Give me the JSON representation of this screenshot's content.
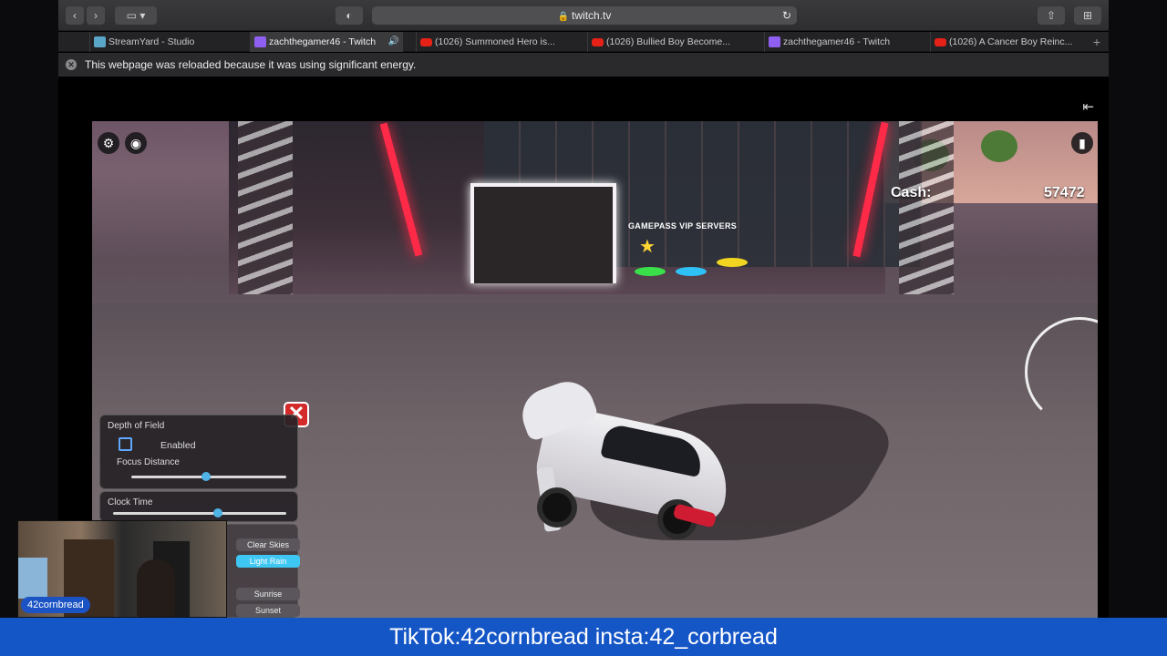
{
  "browser": {
    "url": "twitch.tv",
    "tabs": [
      {
        "label": "StreamYard - Studio",
        "favicon": "streamyard-icon",
        "active": false
      },
      {
        "label": "zachthegamer46 - Twitch",
        "favicon": "twitch-icon",
        "active": true
      },
      {
        "label": "(1026) Summoned Hero is...",
        "favicon": "youtube-icon",
        "active": false
      },
      {
        "label": "(1026) Bullied Boy Become...",
        "favicon": "youtube-icon",
        "active": false
      },
      {
        "label": "zachthegamer46 - Twitch",
        "favicon": "twitch-icon",
        "active": false
      },
      {
        "label": "(1026) A Cancer Boy Reinc...",
        "favicon": "youtube-icon",
        "active": false
      }
    ],
    "notice": "This webpage was reloaded because it was using significant energy."
  },
  "game": {
    "cash_label": "Cash:",
    "cash_value": "57472",
    "sign_text": "GAMEPASS",
    "sign_text2": "VIP SERVERS",
    "panel": {
      "dof_title": "Depth of Field",
      "enabled_label": "Enabled",
      "focus_label": "Focus Distance",
      "focus_value": 0.45,
      "clock_title": "Clock Time",
      "clock_value": 0.58,
      "weather": [
        "Clear Skies",
        "Light Rain"
      ],
      "weather_selected": "Light Rain",
      "time_presets": [
        "Sunrise",
        "Sunset"
      ]
    }
  },
  "stream": {
    "cam_name": "42cornbread",
    "banner": "TikTok:42cornbread insta:42_corbread"
  },
  "colors": {
    "banner": "#1556c7",
    "accent": "#3fc7f4",
    "close": "#d32a2a"
  }
}
